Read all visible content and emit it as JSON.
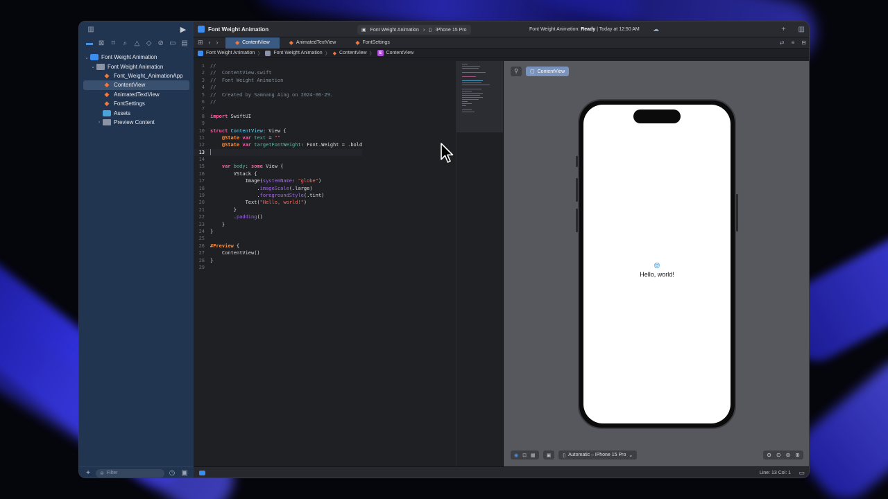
{
  "window": {
    "project_title": "Font Weight Animation",
    "scheme_target": "Font Weight Animation",
    "scheme_device": "iPhone 15 Pro",
    "status_prefix": "Font Weight Animation: ",
    "status_state": "Ready",
    "status_suffix": " | Today at 12:50 AM"
  },
  "navigator": {
    "items": [
      {
        "label": "Font Weight Animation",
        "kind": "project",
        "level": 0,
        "chevron": "⌄"
      },
      {
        "label": "Font Weight Animation",
        "kind": "folder",
        "level": 1,
        "chevron": "⌄"
      },
      {
        "label": "Font_Weight_AnimationApp",
        "kind": "swift",
        "level": 2,
        "chevron": ""
      },
      {
        "label": "ContentView",
        "kind": "swift",
        "level": 2,
        "chevron": "",
        "selected": true
      },
      {
        "label": "AnimatedTextView",
        "kind": "swift",
        "level": 2,
        "chevron": ""
      },
      {
        "label": "FontSettings",
        "kind": "swift",
        "level": 2,
        "chevron": ""
      },
      {
        "label": "Assets",
        "kind": "assets",
        "level": 2,
        "chevron": ""
      },
      {
        "label": "Preview Content",
        "kind": "folder",
        "level": 2,
        "chevron": "›"
      }
    ],
    "filter_placeholder": "Filter"
  },
  "tabs": [
    {
      "label": "ContentView",
      "active": true
    },
    {
      "label": "AnimatedTextView",
      "active": false
    },
    {
      "label": "FontSettings",
      "active": false
    }
  ],
  "breadcrumb": [
    "Font Weight Animation",
    "Font Weight Animation",
    "ContentView",
    "ContentView"
  ],
  "code": {
    "current_line": 13,
    "lines": [
      [
        [
          "c",
          "//"
        ]
      ],
      [
        [
          "c",
          "//  ContentView.swift"
        ]
      ],
      [
        [
          "c",
          "//  Font Weight Animation"
        ]
      ],
      [
        [
          "c",
          "//"
        ]
      ],
      [
        [
          "c",
          "//  Created by Samnang Aing on 2024-06-29."
        ]
      ],
      [
        [
          "c",
          "//"
        ]
      ],
      [],
      [
        [
          "k",
          "import"
        ],
        [
          "p",
          " SwiftUI"
        ]
      ],
      [],
      [
        [
          "k",
          "struct"
        ],
        [
          "p",
          " "
        ],
        [
          "t",
          "ContentView"
        ],
        [
          "p",
          ": View {"
        ]
      ],
      [
        [
          "p",
          "    "
        ],
        [
          "a",
          "@State"
        ],
        [
          "p",
          " "
        ],
        [
          "k",
          "var"
        ],
        [
          "p",
          " "
        ],
        [
          "v",
          "text"
        ],
        [
          "p",
          " = "
        ],
        [
          "s",
          "\"\""
        ]
      ],
      [
        [
          "p",
          "    "
        ],
        [
          "a",
          "@State"
        ],
        [
          "p",
          " "
        ],
        [
          "k",
          "var"
        ],
        [
          "p",
          " "
        ],
        [
          "v",
          "targetFontWeight"
        ],
        [
          "p",
          ": Font.Weight = .bold"
        ]
      ],
      [],
      [],
      [
        [
          "p",
          "    "
        ],
        [
          "k",
          "var"
        ],
        [
          "p",
          " "
        ],
        [
          "v",
          "body"
        ],
        [
          "p",
          ": "
        ],
        [
          "k",
          "some"
        ],
        [
          "p",
          " View {"
        ]
      ],
      [
        [
          "p",
          "        VStack {"
        ]
      ],
      [
        [
          "p",
          "            Image("
        ],
        [
          "m",
          "systemName"
        ],
        [
          "p",
          ": "
        ],
        [
          "s",
          "\"globe\""
        ],
        [
          "p",
          ")"
        ]
      ],
      [
        [
          "p",
          "                ."
        ],
        [
          "m",
          "imageScale"
        ],
        [
          "p",
          "(.large)"
        ]
      ],
      [
        [
          "p",
          "                ."
        ],
        [
          "m",
          "foregroundStyle"
        ],
        [
          "p",
          "(.tint)"
        ]
      ],
      [
        [
          "p",
          "            Text("
        ],
        [
          "s",
          "\"Hello, world!\""
        ],
        [
          "p",
          ")"
        ]
      ],
      [
        [
          "p",
          "        }"
        ]
      ],
      [
        [
          "p",
          "        ."
        ],
        [
          "m",
          "padding"
        ],
        [
          "p",
          "()"
        ]
      ],
      [
        [
          "p",
          "    }"
        ]
      ],
      [
        [
          "p",
          "}"
        ]
      ],
      [],
      [
        [
          "a",
          "#Preview"
        ],
        [
          "p",
          " {"
        ]
      ],
      [
        [
          "p",
          "    ContentView()"
        ]
      ],
      [
        [
          "p",
          "}"
        ]
      ],
      []
    ]
  },
  "canvas": {
    "preview_label": "ContentView",
    "preview_text": "Hello, world!",
    "device_selector": "Automatic – iPhone 15 Pro"
  },
  "statusbar": {
    "position": "Line: 13  Col: 1"
  },
  "colors": {
    "comment": "#7f8c98",
    "keyword": "#fc5fa3",
    "type": "#5dd8ff",
    "attribute": "#fd8f3f",
    "string": "#fc6a5d",
    "variable": "#67b7a4",
    "method": "#a167e6",
    "plain": "#dfdfe0"
  }
}
